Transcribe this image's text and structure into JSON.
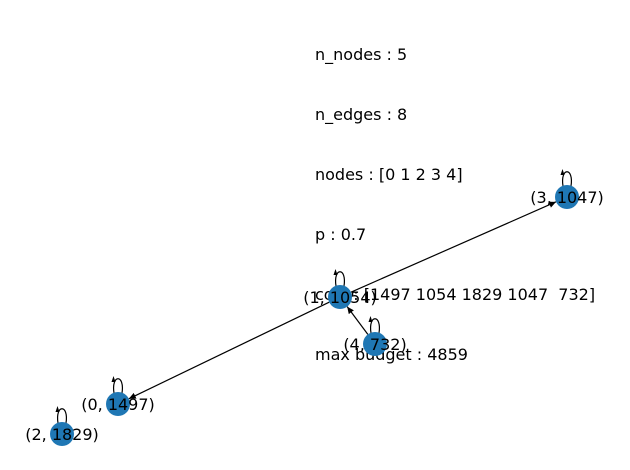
{
  "info": {
    "n_nodes": "n_nodes : 5",
    "n_edges": "n_edges : 8",
    "nodes": "nodes : [0 1 2 3 4]",
    "p": "p : 0.7",
    "cost": "cost : [1497 1054 1829 1047  732]",
    "max_budget": "max budget : 4859"
  },
  "graph": {
    "node_color": "#1f77b4",
    "edge_color": "#000000",
    "nodes": [
      {
        "id": 0,
        "label": "(0, 1497)"
      },
      {
        "id": 1,
        "label": "(1, 1054)"
      },
      {
        "id": 2,
        "label": "(2, 1829)"
      },
      {
        "id": 3,
        "label": "(3, 1047)"
      },
      {
        "id": 4,
        "label": "(4, 732)"
      }
    ],
    "edges": [
      {
        "from": 0,
        "to": 0
      },
      {
        "from": 1,
        "to": 1
      },
      {
        "from": 2,
        "to": 2
      },
      {
        "from": 3,
        "to": 3
      },
      {
        "from": 4,
        "to": 4
      },
      {
        "from": 1,
        "to": 0
      },
      {
        "from": 1,
        "to": 3
      },
      {
        "from": 4,
        "to": 1
      }
    ]
  }
}
